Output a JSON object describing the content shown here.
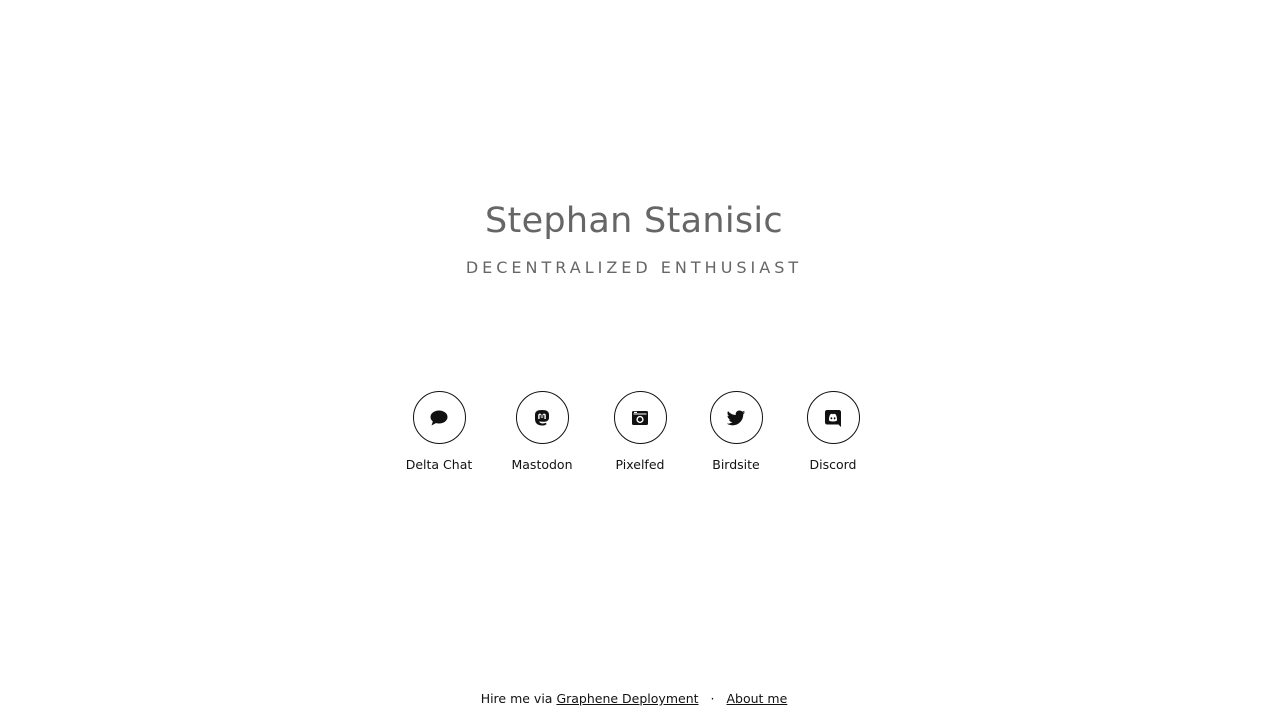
{
  "header": {
    "name": "Stephan Stanisic",
    "tagline": "DECENTRALIZED ENTHUSIAST"
  },
  "social": [
    {
      "label": "Delta Chat",
      "icon": "speech-bubble-icon"
    },
    {
      "label": "Mastodon",
      "icon": "mastodon-icon"
    },
    {
      "label": "Pixelfed",
      "icon": "camera-icon"
    },
    {
      "label": "Birdsite",
      "icon": "twitter-bird-icon"
    },
    {
      "label": "Discord",
      "icon": "discord-icon"
    }
  ],
  "footer": {
    "prefix": "Hire me via ",
    "hire_link": "Graphene Deployment",
    "separator": "·",
    "about_link": "About me"
  },
  "colors": {
    "heading": "#666666",
    "text": "#111111",
    "background": "#ffffff"
  }
}
